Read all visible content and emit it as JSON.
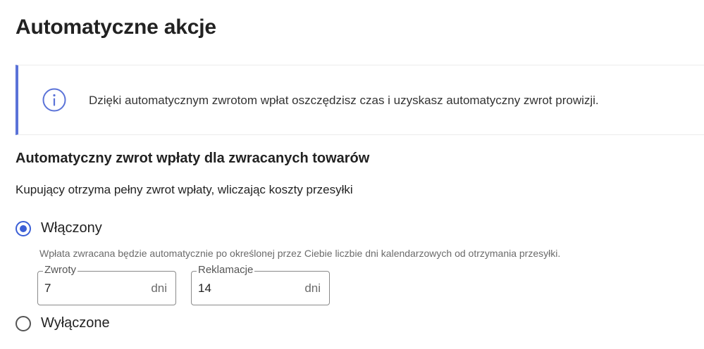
{
  "page": {
    "title": "Automatyczne akcje"
  },
  "info": {
    "icon": "info-icon",
    "text": "Dzięki automatycznym zwrotom wpłat oszczędzisz czas i uzyskasz automatyczny zwrot prowizji."
  },
  "section": {
    "title": "Automatyczny zwrot wpłaty dla zwracanych towarów",
    "description": "Kupujący otrzyma pełny zwrot wpłaty, wliczając koszty przesyłki"
  },
  "options": {
    "on": {
      "label": "Włączony",
      "checked": true,
      "help": "Wpłata zwracana będzie automatycznie po określonej przez Ciebie liczbie dni kalendarzowych od otrzymania przesyłki."
    },
    "off": {
      "label": "Wyłączone",
      "checked": false
    }
  },
  "fields": {
    "returns": {
      "label": "Zwroty",
      "value": "7",
      "unit": "dni"
    },
    "complaints": {
      "label": "Reklamacje",
      "value": "14",
      "unit": "dni"
    }
  },
  "colors": {
    "accent": "#3b5fd6",
    "info_border": "#5b73d8"
  }
}
